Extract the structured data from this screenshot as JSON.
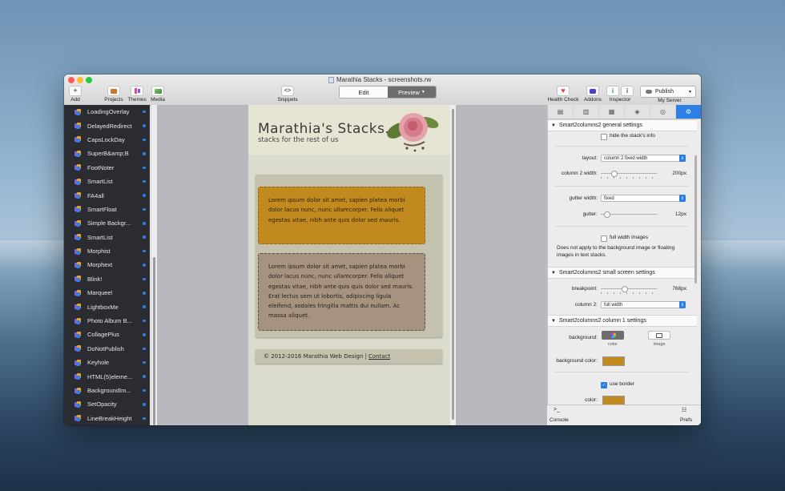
{
  "window": {
    "title": "Marathia Stacks - screenshots.rw",
    "traffic_colors": [
      "#fc5f57",
      "#fdbc2e",
      "#29c940"
    ]
  },
  "toolbar": {
    "add": "Add",
    "projects": "Projects",
    "themes": "Themes",
    "media": "Media",
    "snippets": "Snippets",
    "edit": "Edit",
    "preview": "Preview",
    "health_check": "Health Check",
    "addons": "Addons",
    "inspector": "Inspector",
    "publish": "Publish",
    "my_server": "My Server"
  },
  "sidebar": {
    "items": [
      {
        "label": "LoadingOverlay"
      },
      {
        "label": "DelayedRedirect"
      },
      {
        "label": "CapsLockDay"
      },
      {
        "label": "SuperB&amp;B"
      },
      {
        "label": "FootNoter"
      },
      {
        "label": "SmartList"
      },
      {
        "label": "FA4all"
      },
      {
        "label": "SmartFloat"
      },
      {
        "label": "Simple Backgr..."
      },
      {
        "label": "SmartList"
      },
      {
        "label": "Morphist"
      },
      {
        "label": "Morphext"
      },
      {
        "label": "Blink!"
      },
      {
        "label": "Marquee!"
      },
      {
        "label": "LightboxMe"
      },
      {
        "label": "Photo Album B..."
      },
      {
        "label": "CollagePlus"
      },
      {
        "label": "DoNotPublish"
      },
      {
        "label": "Keyhole"
      },
      {
        "label": "HTML(5)eleme..."
      },
      {
        "label": "BackgroundIm..."
      },
      {
        "label": "SetOpacity"
      },
      {
        "label": "LineBreakHeight"
      }
    ]
  },
  "preview": {
    "site_title": "Marathia's Stacks.",
    "tagline": "stacks for the rest of us",
    "tile1": "Lorem ipsum dolor sit amet, sapien platea morbi dolor lacus nunc, nunc ullamcorper. Felis aliquet egestas vitae, nibh ante quis dolor sed mauris.",
    "tile2": "Lorem ipsum dolor sit amet, sapien platea morbi dolor lacus nunc, nunc ullamcorper. Felis aliquet egestas vitae, nibh ante quis quis dolor sed mauris. Erat lectus sem ut lobortis, adipiscing ligula eleifend, sodales fringilla mattis dui nullam. Ac massa aliquet.",
    "footer_text": "© 2012-2016 Marathia Web Design |",
    "footer_link": "Contact"
  },
  "inspector": {
    "section1": "Smart2columns2 general settings",
    "hide_info": "hide the stack's info",
    "layout_label": "layout:",
    "layout_value": "column 2 fixed width",
    "col2_width_label": "column 2 width:",
    "col2_width_value": "200px",
    "col2_width_level": 0.2,
    "gutter_width_label": "gutter width:",
    "gutter_width_value": "fixed",
    "gutter_label": "gutter:",
    "gutter_value": "12px",
    "gutter_level": 0.06,
    "full_width_images": "full width images",
    "note": "Does not apply to the background image or floating images in text stacks.",
    "section2": "Smart2columns2 small screen settings",
    "breakpoint_label": "breakpoint:",
    "breakpoint_value": "768px",
    "breakpoint_level": 0.4,
    "column2_label": "column 2:",
    "column2_value": "full width",
    "section3": "Smart2columns2 column 1 settings",
    "background_label": "background:",
    "color_opt": "color",
    "image_opt": "image",
    "bg_color_label": "background color:",
    "use_border": "use border",
    "color_label": "color:",
    "swatch_color": "#c08a1f",
    "console": "Console",
    "prefs": "Prefs"
  }
}
